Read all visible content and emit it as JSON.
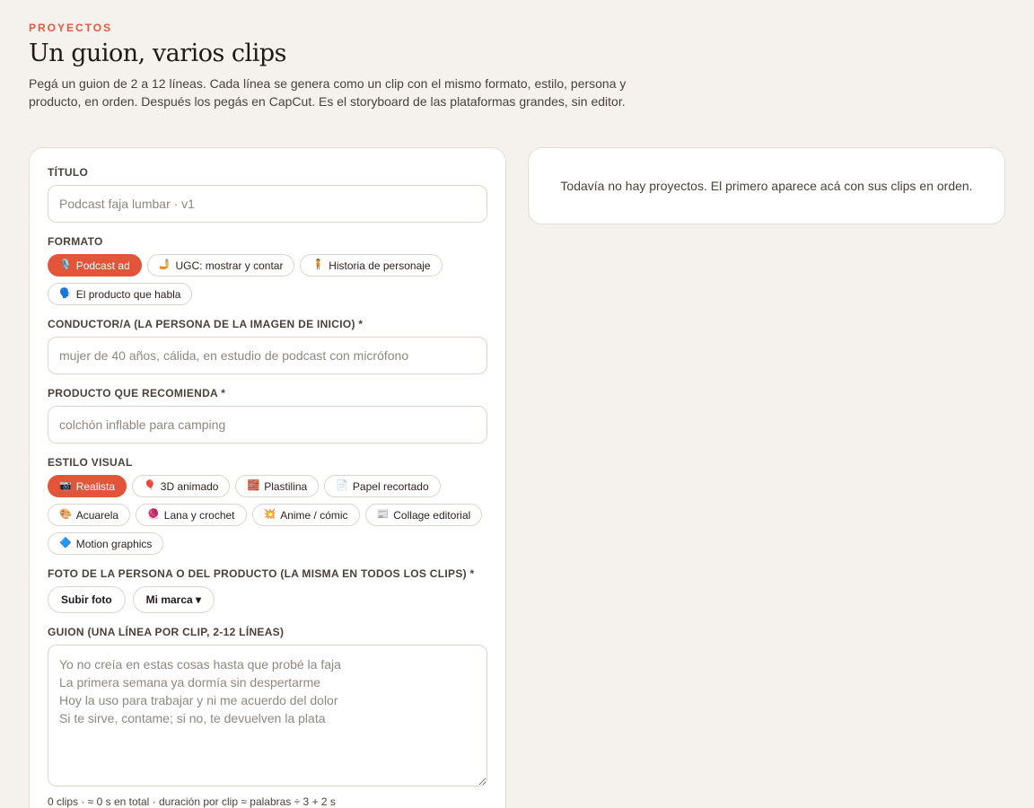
{
  "header": {
    "eyebrow": "PROYECTOS",
    "title": "Un guion, varios clips",
    "subtitle": "Pegá un guion de 2 a 12 líneas. Cada línea se genera como un clip con el mismo formato, estilo, persona y producto, en orden. Después los pegás en CapCut. Es el storyboard de las plataformas grandes, sin editor."
  },
  "colors": {
    "accent": "#e2553a",
    "background": "#f5f1ec",
    "card": "#ffffff"
  },
  "form": {
    "title_label": "TÍTULO",
    "title_placeholder": "Podcast faja lumbar · v1",
    "format_label": "FORMATO",
    "formats": [
      {
        "icon": "🎙️",
        "icon_name": "microphone-icon",
        "label": "Podcast ad",
        "active": true
      },
      {
        "icon": "🤳",
        "icon_name": "selfie-icon",
        "label": "UGC: mostrar y contar",
        "active": false
      },
      {
        "icon": "🧍",
        "icon_name": "person-standing-icon",
        "label": "Historia de personaje",
        "active": false
      },
      {
        "icon": "🗣️",
        "icon_name": "speaking-head-icon",
        "label": "El producto que habla",
        "active": false
      }
    ],
    "host_label": "CONDUCTOR/A (LA PERSONA DE LA IMAGEN DE INICIO) *",
    "host_placeholder": "mujer de 40 años, cálida, en estudio de podcast con micrófono",
    "product_label": "PRODUCTO QUE RECOMIENDA *",
    "product_placeholder": "colchón inflable para camping",
    "style_label": "ESTILO VISUAL",
    "styles": [
      {
        "icon": "📷",
        "icon_name": "camera-icon",
        "label": "Realista",
        "active": true
      },
      {
        "icon": "🎈",
        "icon_name": "balloon-icon",
        "label": "3D animado",
        "active": false
      },
      {
        "icon": "🧱",
        "icon_name": "bricks-icon",
        "label": "Plastilina",
        "active": false
      },
      {
        "icon": "📄",
        "icon_name": "page-icon",
        "label": "Papel recortado",
        "active": false
      },
      {
        "icon": "🎨",
        "icon_name": "palette-icon",
        "label": "Acuarela",
        "active": false
      },
      {
        "icon": "🧶",
        "icon_name": "yarn-icon",
        "label": "Lana y crochet",
        "active": false
      },
      {
        "icon": "💥",
        "icon_name": "collision-icon",
        "label": "Anime / cómic",
        "active": false
      },
      {
        "icon": "📰",
        "icon_name": "newspaper-icon",
        "label": "Collage editorial",
        "active": false
      },
      {
        "icon": "🔷",
        "icon_name": "blue-diamond-icon",
        "label": "Motion graphics",
        "active": false
      }
    ],
    "photo_label": "FOTO DE LA PERSONA O DEL PRODUCTO (LA MISMA EN TODOS LOS CLIPS) *",
    "upload_button": "Subir foto",
    "brand_button": "Mi marca ▾",
    "script_label": "GUION (UNA LÍNEA POR CLIP, 2-12 LÍNEAS)",
    "script_placeholder": "Yo no creía en estas cosas hasta que probé la faja\nLa primera semana ya dormía sin despertarme\nHoy la uso para trabajar y ni me acuerdo del dolor\nSi te sirve, contame; si no, te devuelven la plata",
    "hint": "0 clips · ≈ 0 s en total · duración por clip ≈ palabras ÷ 3 + 2 s"
  },
  "projects": {
    "empty_text": "Todavía no hay proyectos. El primero aparece acá con sus clips en orden."
  }
}
